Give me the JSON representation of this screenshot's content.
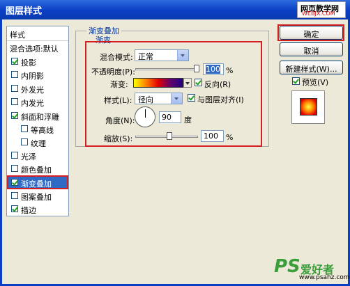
{
  "window": {
    "title": "图层样式"
  },
  "watermark": {
    "site_cn": "网页教学网",
    "site_url": "WEBJX.COM"
  },
  "styles_panel": {
    "header": "样式",
    "blend_default": "混合选项:默认",
    "items": [
      {
        "label": "投影",
        "checked": true
      },
      {
        "label": "内阴影",
        "checked": false
      },
      {
        "label": "外发光",
        "checked": false
      },
      {
        "label": "内发光",
        "checked": false
      },
      {
        "label": "斜面和浮雕",
        "checked": true
      },
      {
        "label": "等高线",
        "checked": false
      },
      {
        "label": "纹理",
        "checked": false
      },
      {
        "label": "光泽",
        "checked": false
      },
      {
        "label": "颜色叠加",
        "checked": false
      },
      {
        "label": "渐变叠加",
        "checked": true,
        "selected": true
      },
      {
        "label": "图案叠加",
        "checked": false
      },
      {
        "label": "描边",
        "checked": true
      }
    ]
  },
  "gradient_overlay": {
    "group_title": "渐变叠加",
    "sub_title": "渐变",
    "blend_mode_label": "混合模式:",
    "blend_mode_value": "正常",
    "opacity_label": "不透明度(P):",
    "opacity_value": "100",
    "opacity_level": 1.0,
    "percent": "%",
    "gradient_label": "渐变:",
    "reverse_label": "反向(R)",
    "reverse_checked": true,
    "style_label": "样式(L):",
    "style_value": "径向",
    "align_label": "与图层对齐(I)",
    "align_checked": true,
    "angle_label": "角度(N):",
    "angle_value": "90",
    "angle_unit": "度",
    "scale_label": "缩放(S):",
    "scale_value": "100",
    "scale_level": 0.5
  },
  "buttons": {
    "ok": "确定",
    "cancel": "取消",
    "new_style": "新建样式(W)...",
    "preview_label": "预览(V)",
    "preview_checked": true
  },
  "logo": {
    "ps": "PS",
    "cn": "爱好者",
    "url": "www.psahz.com"
  },
  "colors": {
    "accent": "#D31F1F",
    "selection": "#316AC5",
    "title_bar": "#0A3FC4"
  }
}
